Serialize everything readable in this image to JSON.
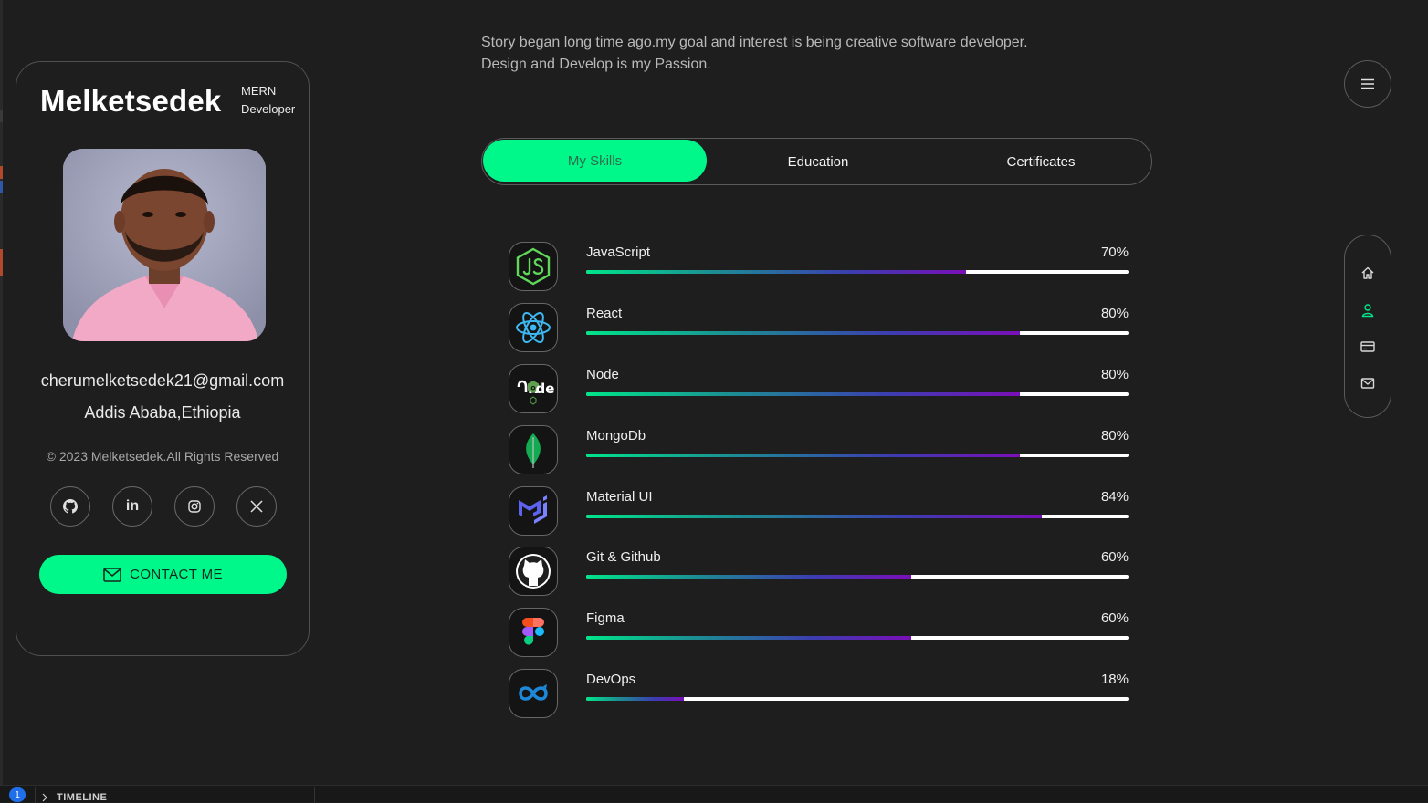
{
  "profile": {
    "name": "Melketsedek",
    "role_line1": "MERN",
    "role_line2": "Developer",
    "email": "cherumelketsedek21@gmail.com",
    "location": "Addis Ababa,Ethiopia",
    "copyright": "© 2023 Melketsedek.All Rights Reserved",
    "socials": [
      {
        "icon": "github-icon"
      },
      {
        "icon": "linkedin-icon"
      },
      {
        "icon": "instagram-icon"
      },
      {
        "icon": "x-icon"
      }
    ],
    "contact_label": "CONTACT ME"
  },
  "intro": {
    "line1": "Story began long time ago.my goal and interest is being creative software developer.",
    "line2": "Design and Develop is my Passion."
  },
  "tabs": [
    {
      "label": "My Skills",
      "active": true
    },
    {
      "label": "Education",
      "active": false
    },
    {
      "label": "Certificates",
      "active": false
    }
  ],
  "skills": [
    {
      "name": "JavaScript",
      "percent_label": "70%",
      "progress": 70,
      "icon": "javascript-icon"
    },
    {
      "name": "React",
      "percent_label": "80%",
      "progress": 80,
      "icon": "react-icon"
    },
    {
      "name": "Node",
      "percent_label": "80%",
      "progress": 80,
      "icon": "node-icon"
    },
    {
      "name": "MongoDb",
      "percent_label": "80%",
      "progress": 80,
      "icon": "mongodb-icon"
    },
    {
      "name": "Material UI",
      "percent_label": "84%",
      "progress": 84,
      "icon": "material-ui-icon"
    },
    {
      "name": "Git & Github",
      "percent_label": "60%",
      "progress": 60,
      "icon": "github-icon"
    },
    {
      "name": "Figma",
      "percent_label": "60%",
      "progress": 60,
      "icon": "figma-icon"
    },
    {
      "name": "DevOps",
      "percent_label": "18%",
      "progress": 18,
      "icon": "devops-icon"
    }
  ],
  "nav": [
    {
      "icon": "home-icon",
      "active": false
    },
    {
      "icon": "user-icon",
      "active": true
    },
    {
      "icon": "card-icon",
      "active": false
    },
    {
      "icon": "mail-icon",
      "active": false
    }
  ],
  "bottom": {
    "timeline_label": "TIMELINE",
    "badge_count": "1"
  },
  "colors": {
    "accent": "#00f78a",
    "background": "#1e1e1e",
    "active_nav": "#00e58a"
  }
}
